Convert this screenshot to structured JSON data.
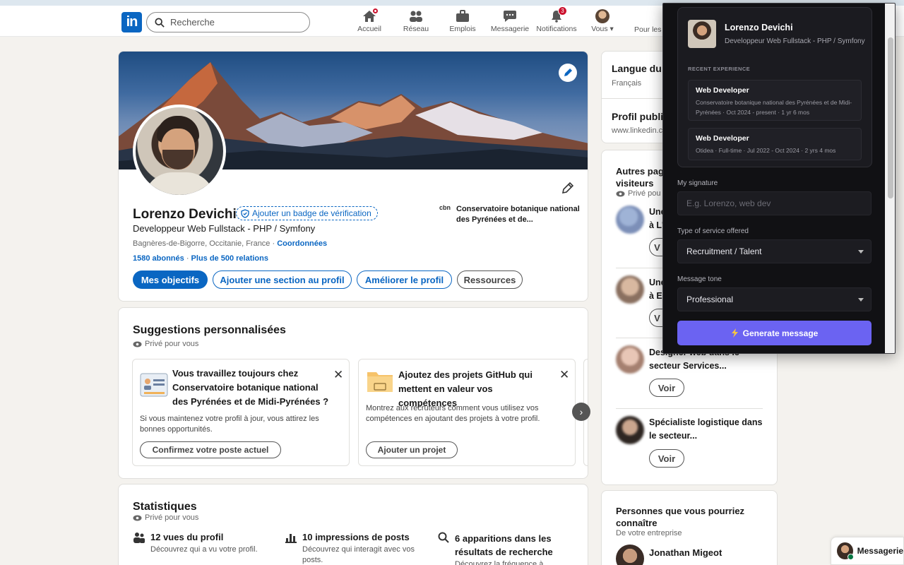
{
  "header": {
    "logo": "in",
    "search_placeholder": "Recherche",
    "nav": [
      {
        "label": "Accueil",
        "icon": "home-icon"
      },
      {
        "label": "Réseau",
        "icon": "network-icon"
      },
      {
        "label": "Emplois",
        "icon": "briefcase-icon"
      },
      {
        "label": "Messagerie",
        "icon": "message-icon"
      },
      {
        "label": "Notifications",
        "icon": "bell-icon",
        "badge": "3"
      },
      {
        "label": "Vous ▾",
        "icon": "me-avatar"
      }
    ],
    "business": "Pour les e"
  },
  "profile": {
    "name": "Lorenzo Devichi",
    "verify_badge": "Ajouter un badge de vérification",
    "headline": "Developpeur Web Fullstack - PHP / Symfony",
    "location": "Bagnères-de-Bigorre, Occitanie, France ·",
    "contact_link": "Coordonnées",
    "followers": "1580 abonnés",
    "separator": " · ",
    "connections": "Plus de 500 relations",
    "company_logo": "cbn",
    "company_name": "Conservatoire botanique national des Pyrénées et de...",
    "buttons": {
      "goals": "Mes objectifs",
      "add_section": "Ajouter une section au profil",
      "improve": "Améliorer le profil",
      "resources": "Ressources"
    }
  },
  "suggestions": {
    "title": "Suggestions personnalisées",
    "private": "Privé pour vous",
    "cards": [
      {
        "title": "Vous travaillez toujours chez Conservatoire botanique national des Pyrénées et de Midi-Pyrénées ?",
        "body": "Si vous maintenez votre profil à jour, vous attirez les bonnes opportunités.",
        "button": "Confirmez votre poste actuel"
      },
      {
        "title": "Ajoutez des projets GitHub qui mettent en valeur vos compétences",
        "body": "Montrez aux recruteurs comment vous utilisez vos compétences en ajoutant des projets à votre profil.",
        "button": "Ajouter un projet"
      }
    ],
    "close": "✕",
    "next": "›"
  },
  "stats": {
    "title": "Statistiques",
    "private": "Privé pour vous",
    "items": [
      {
        "title": "12 vues du profil",
        "desc": "Découvrez qui a vu votre profil."
      },
      {
        "title": "10 impressions de posts",
        "desc": "Découvrez qui interagit avec vos posts."
      },
      {
        "title": "6 apparitions dans les résultats de recherche",
        "desc": "Découvrez la fréquence à"
      }
    ]
  },
  "sidebar": {
    "lang_title": "Langue du",
    "lang_value": "Français",
    "public_title": "Profil publi",
    "public_url": "www.linkedin.c",
    "others_title": "Autres pag visiteurs",
    "others_private": "Privé pou",
    "people": [
      {
        "text": "Une à L'",
        "btn": "V"
      },
      {
        "text": "Une à E",
        "btn": "V"
      },
      {
        "text": "Designer web dans le secteur Services...",
        "btn": "Voir"
      },
      {
        "text": "Spécialiste logistique dans le secteur...",
        "btn": "Voir"
      }
    ],
    "pymk_title": "Personnes que vous pourriez connaître",
    "pymk_sub": "De votre entreprise",
    "pymk_person": "Jonathan Migeot"
  },
  "extension": {
    "name": "Lorenzo Devichi",
    "role": "Developpeur Web Fullstack - PHP / Symfony",
    "recent_label": "RECENT EXPERIENCE",
    "experiences": [
      {
        "title": "Web Developer",
        "desc": "Conservatoire botanique national des Pyrénées et de Midi-Pyrénées · Oct 2024 - present · 1 yr 6 mos"
      },
      {
        "title": "Web Developer",
        "desc": "Otidea · Full-time · Jul 2022 - Oct 2024 · 2 yrs 4 mos"
      }
    ],
    "signature_label": "My signature",
    "signature_placeholder": "E.g. Lorenzo, web dev",
    "service_label": "Type of service offered",
    "service_value": "Recruitment / Talent",
    "tone_label": "Message tone",
    "tone_value": "Professional",
    "generate": "Generate message"
  },
  "messaging": {
    "label": "Messagerie"
  },
  "colors": {
    "brand": "#0a66c2",
    "accent": "#6b63f2",
    "badge": "#cb112d"
  }
}
